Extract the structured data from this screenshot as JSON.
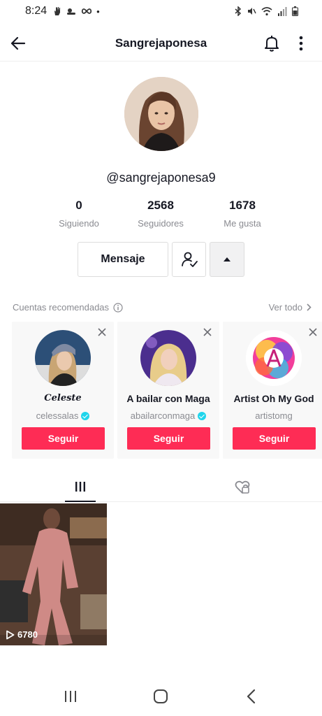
{
  "status_bar": {
    "time": "8:24",
    "dot": "•"
  },
  "header": {
    "title": "Sangrejaponesa"
  },
  "profile": {
    "handle": "@sangrejaponesa9"
  },
  "stats": [
    {
      "value": "0",
      "label": "Siguiendo"
    },
    {
      "value": "2568",
      "label": "Seguidores"
    },
    {
      "value": "1678",
      "label": "Me gusta"
    }
  ],
  "actions": {
    "message_label": "Mensaje"
  },
  "recommended": {
    "title": "Cuentas recomendadas",
    "see_all": "Ver todo",
    "accounts": [
      {
        "name": "Celeste",
        "handle": "celessalas",
        "verified": true,
        "follow_label": "Seguir"
      },
      {
        "name": "A bailar con Maga",
        "handle": "abailarconmaga",
        "verified": true,
        "follow_label": "Seguir"
      },
      {
        "name": "Artist Oh My God",
        "handle": "artistomg",
        "verified": false,
        "follow_label": "Seguir"
      }
    ]
  },
  "videos": [
    {
      "views": "6780"
    }
  ],
  "colors": {
    "accent": "#fe2c55",
    "verified": "#20d5ec",
    "muted": "#8a8b91"
  },
  "icons": {
    "back": "arrow-left-icon",
    "bell": "bell-icon",
    "more": "more-vertical-icon",
    "follow_status": "user-check-icon",
    "expand": "caret-up-icon",
    "info": "info-icon",
    "chevron": "chevron-right-icon",
    "close": "close-icon",
    "videos_tab": "grid-icon",
    "liked_tab": "liked-hidden-icon",
    "play": "play-icon",
    "nav_recent": "recent-apps-icon",
    "nav_home": "home-icon",
    "nav_back": "nav-back-icon"
  }
}
